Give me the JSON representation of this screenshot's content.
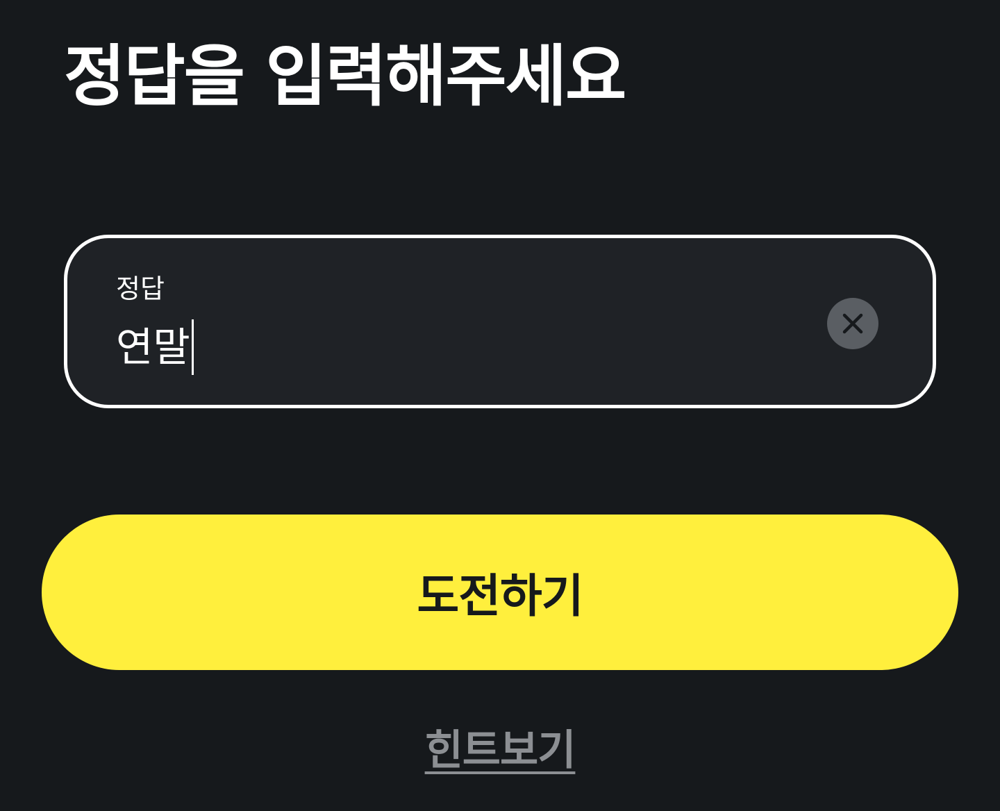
{
  "page": {
    "title": "정답을 입력해주세요"
  },
  "answer_field": {
    "label": "정답",
    "value": "연말",
    "clear_icon": "close-icon"
  },
  "actions": {
    "submit_label": "도전하기",
    "hint_label": "힌트보기"
  },
  "colors": {
    "background": "#16191c",
    "field_background": "#1f2226",
    "field_border": "#ffffff",
    "accent": "#ffef3d",
    "clear_button": "#5a5e63",
    "hint_text": "#8c8f93"
  }
}
